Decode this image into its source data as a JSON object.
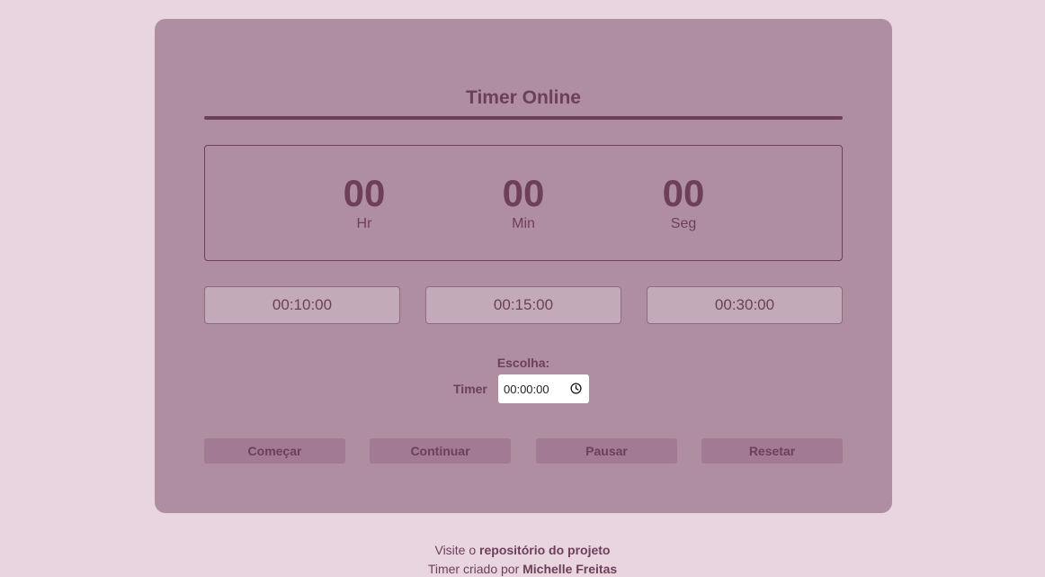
{
  "title": "Timer Online",
  "display": {
    "hours": "00",
    "hours_label": "Hr",
    "minutes": "00",
    "minutes_label": "Min",
    "seconds": "00",
    "seconds_label": "Seg"
  },
  "presets": [
    "00:10:00",
    "00:15:00",
    "00:30:00"
  ],
  "chooser": {
    "heading": "Escolha:",
    "label": "Timer",
    "value": "00:00:00"
  },
  "controls": {
    "start": "Começar",
    "continue": "Continuar",
    "pause": "Pausar",
    "reset": "Resetar"
  },
  "footer": {
    "visit_text": "Visite o",
    "repo_link": "repositório do projeto",
    "credit_text": "Timer criado por",
    "author_link": "Michelle Freitas"
  },
  "colors": {
    "page_bg": "#e8d5e0",
    "card_bg": "#b08ea1",
    "accent": "#6e3f58"
  }
}
